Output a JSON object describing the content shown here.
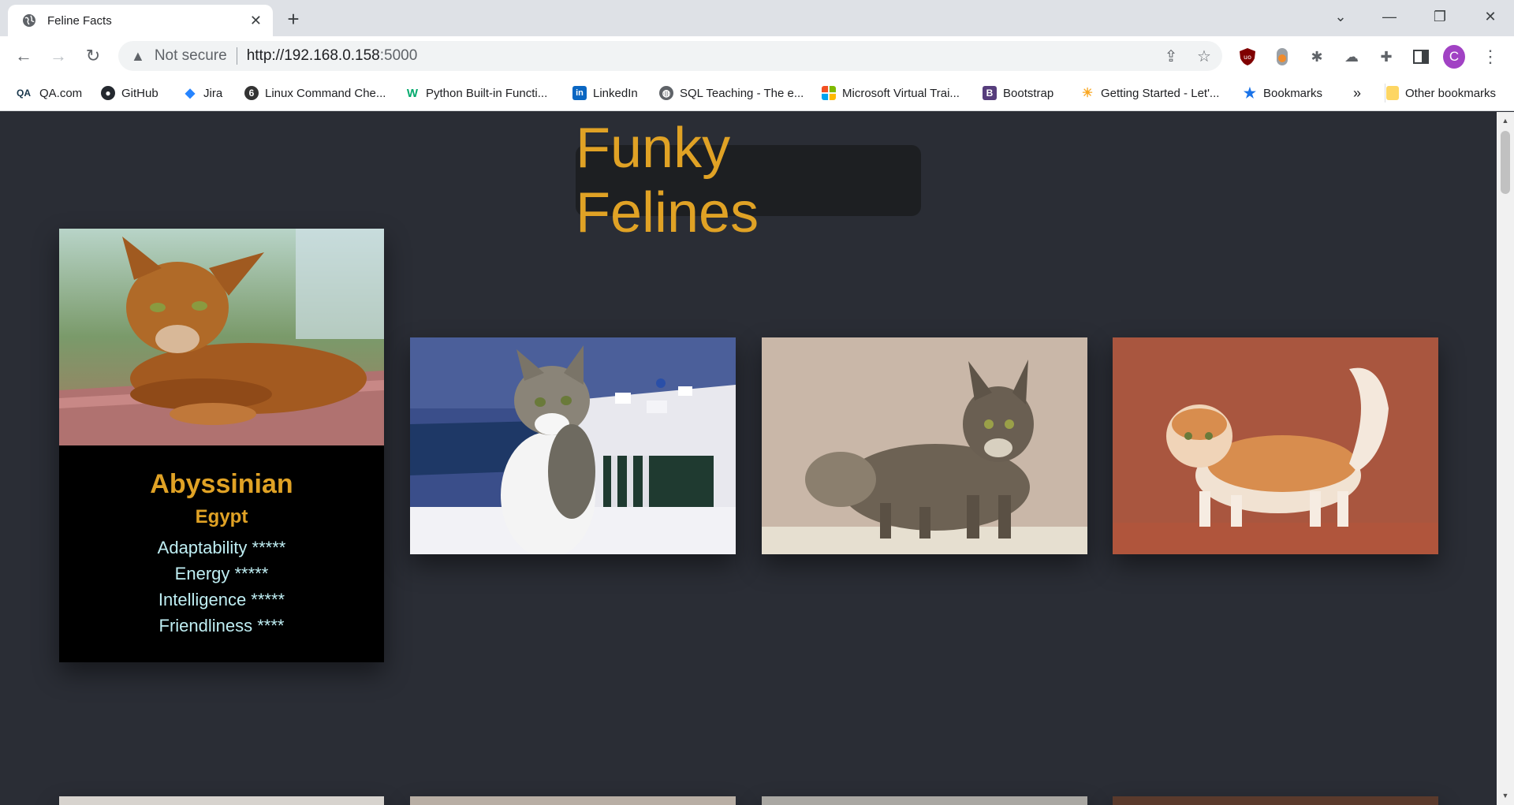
{
  "browser": {
    "tab_title": "Feline Facts",
    "new_tab_label": "+",
    "address": {
      "security_label": "Not secure",
      "url_host": "http://192.168.0.158",
      "url_port": ":5000"
    },
    "profile_initial": "C",
    "bookmarks": [
      {
        "label": "QA.com",
        "icon": "qa-logo-icon"
      },
      {
        "label": "GitHub",
        "icon": "github-icon"
      },
      {
        "label": "Jira",
        "icon": "jira-icon"
      },
      {
        "label": "Linux Command Che...",
        "icon": "linux-icon"
      },
      {
        "label": "Python Built-in Functi...",
        "icon": "w3schools-icon"
      },
      {
        "label": "LinkedIn",
        "icon": "linkedin-icon"
      },
      {
        "label": "SQL Teaching - The e...",
        "icon": "globe-icon"
      },
      {
        "label": "Microsoft Virtual Trai...",
        "icon": "microsoft-icon"
      },
      {
        "label": "Bootstrap",
        "icon": "bootstrap-icon"
      },
      {
        "label": "Getting Started - Let'...",
        "icon": "lets-encrypt-icon"
      },
      {
        "label": "Bookmarks",
        "icon": "star-icon"
      }
    ],
    "overflow_label": "»",
    "other_bookmarks_label": "Other bookmarks"
  },
  "page": {
    "heading": "Funky Felines",
    "featured_card": {
      "breed": "Abyssinian",
      "origin": "Egypt",
      "stats": [
        "Adaptability *****",
        "Energy *****",
        "Intelligence *****",
        "Friendliness ****"
      ]
    }
  },
  "colors": {
    "page_background": "#2a2d35",
    "accent_gold": "#e0a225",
    "stat_text": "#bfeef3"
  }
}
